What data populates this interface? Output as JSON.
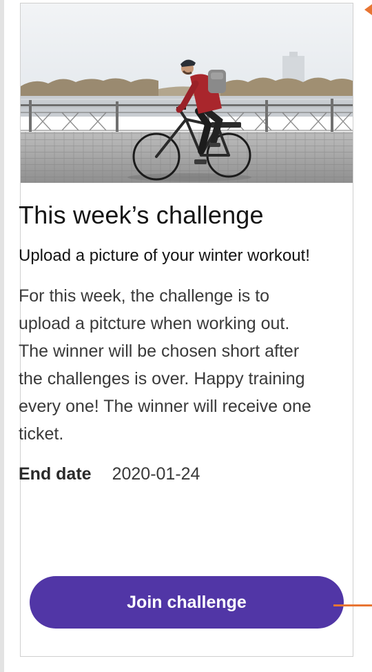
{
  "card": {
    "image_alt": "man-riding-bicycle-photo",
    "title": "This week’s challenge",
    "subtitle": "Upload a picture of your winter workout!",
    "description": "For this week, the challenge is to upload a pitcture when working out. The winner will be chosen short after the challenges is over. Happy training every one! The winner will receive one ticket.",
    "end_date_label": "End date",
    "end_date_value": "2020-01-24",
    "join_label": "Join challenge"
  },
  "colors": {
    "button": "#5136a6",
    "button_text": "#ffffff",
    "connector": "#e87533"
  }
}
